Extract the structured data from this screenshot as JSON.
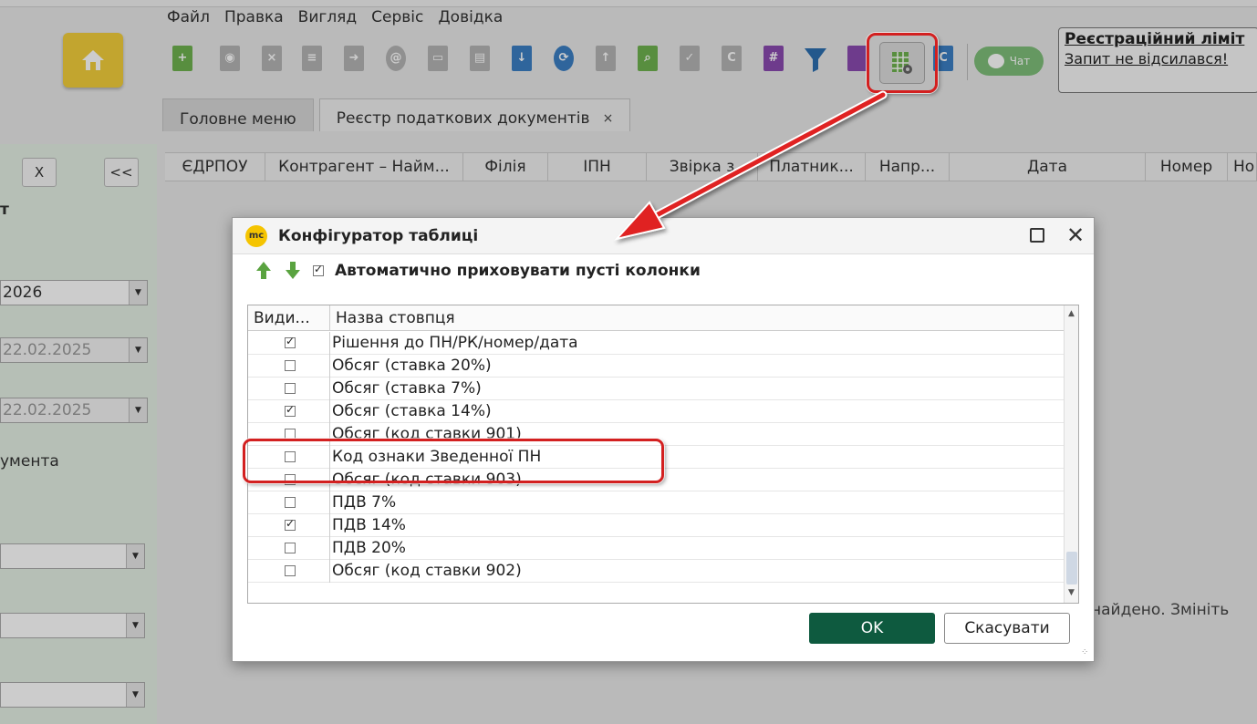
{
  "menu": [
    "Файл",
    "Правка",
    "Вигляд",
    "Сервіс",
    "Довідка"
  ],
  "chat": {
    "label": "Чат"
  },
  "registration": {
    "title": "Реєстраційний ліміт",
    "status": "Запит не відсилався!"
  },
  "tabs": [
    {
      "label": "Головне меню"
    },
    {
      "label": "Реєстр податкових документів",
      "close": "×"
    }
  ],
  "grid_columns": [
    "ЄДРПОУ",
    "Контрагент – Найм...",
    "Філія",
    "ІПН",
    "Звірка з",
    "Платник...",
    "Напр...",
    "Дата",
    "Номер",
    "Но"
  ],
  "left_panel": {
    "close_btn": "X",
    "collapse_btn": "<<",
    "label_t": "т",
    "year": "2026",
    "date_from": "22.02.2025",
    "date_to": "22.02.2025",
    "label_doc": "умента"
  },
  "empty_message": "найдено. Змініть",
  "dialog": {
    "logo": "mc",
    "title": "Конфігуратор таблиці",
    "auto_hide_label": "Автоматично приховувати пусті колонки",
    "auto_hide_checked": true,
    "table_headers": {
      "visible": "Види...",
      "name": "Назва стовпця"
    },
    "rows": [
      {
        "checked": true,
        "name": "Рішення до ПН/РК/номер/дата"
      },
      {
        "checked": false,
        "name": "Обсяг (ставка 20%)"
      },
      {
        "checked": false,
        "name": "Обсяг (ставка 7%)"
      },
      {
        "checked": true,
        "name": "Обсяг (ставка 14%)"
      },
      {
        "checked": false,
        "name": "Обсяг (код ставки 901)"
      },
      {
        "checked": false,
        "name": "Код ознаки Зведенної ПН"
      },
      {
        "checked": false,
        "name": "Обсяг (код ставки 903)"
      },
      {
        "checked": false,
        "name": "ПДВ 7%"
      },
      {
        "checked": true,
        "name": "ПДВ 14%"
      },
      {
        "checked": false,
        "name": "ПДВ 20%"
      },
      {
        "checked": false,
        "name": "Обсяг (код ставки 902)"
      }
    ],
    "ok": "OK",
    "cancel": "Скасувати"
  },
  "colors": {
    "accent": "#0e5a3f",
    "highlight": "#d32020",
    "brand_yellow": "#f3cf3b"
  }
}
